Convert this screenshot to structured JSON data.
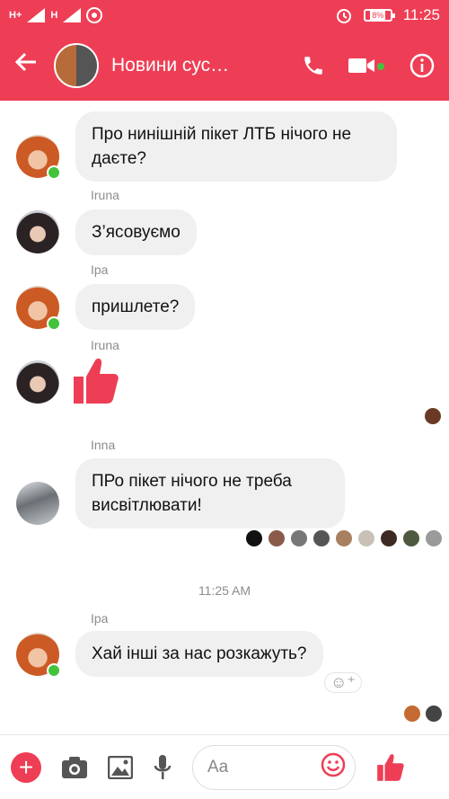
{
  "status_bar": {
    "network_1": "H+",
    "network_2": "H",
    "battery": "8%",
    "time": "11:25"
  },
  "header": {
    "title": "Новини сус…",
    "accent_color": "#ee3e55"
  },
  "messages": [
    {
      "sender": "",
      "text": "Про нинішній пікет ЛТБ нічого не даєте?"
    },
    {
      "sender": "Iruna",
      "text": "З’ясовуємо"
    },
    {
      "sender": "Іра",
      "text": "пришлете?"
    },
    {
      "sender": "Iruna",
      "text": "",
      "sticker": "thumbs-up"
    },
    {
      "sender": "Inna",
      "text": "ПРо пікет нічого не треба висвітлювати!"
    },
    {
      "sender": "Іра",
      "text": "Хай інші за нас розкажуть?"
    }
  ],
  "timestamp": "11:25 AM",
  "composer": {
    "placeholder": "Aa"
  },
  "icons": [
    "back-arrow-icon",
    "phone-icon",
    "video-camera-icon",
    "info-icon",
    "plus-icon",
    "camera-icon",
    "image-icon",
    "microphone-icon",
    "emoji-icon",
    "thumbs-up-icon",
    "add-reaction-icon"
  ]
}
